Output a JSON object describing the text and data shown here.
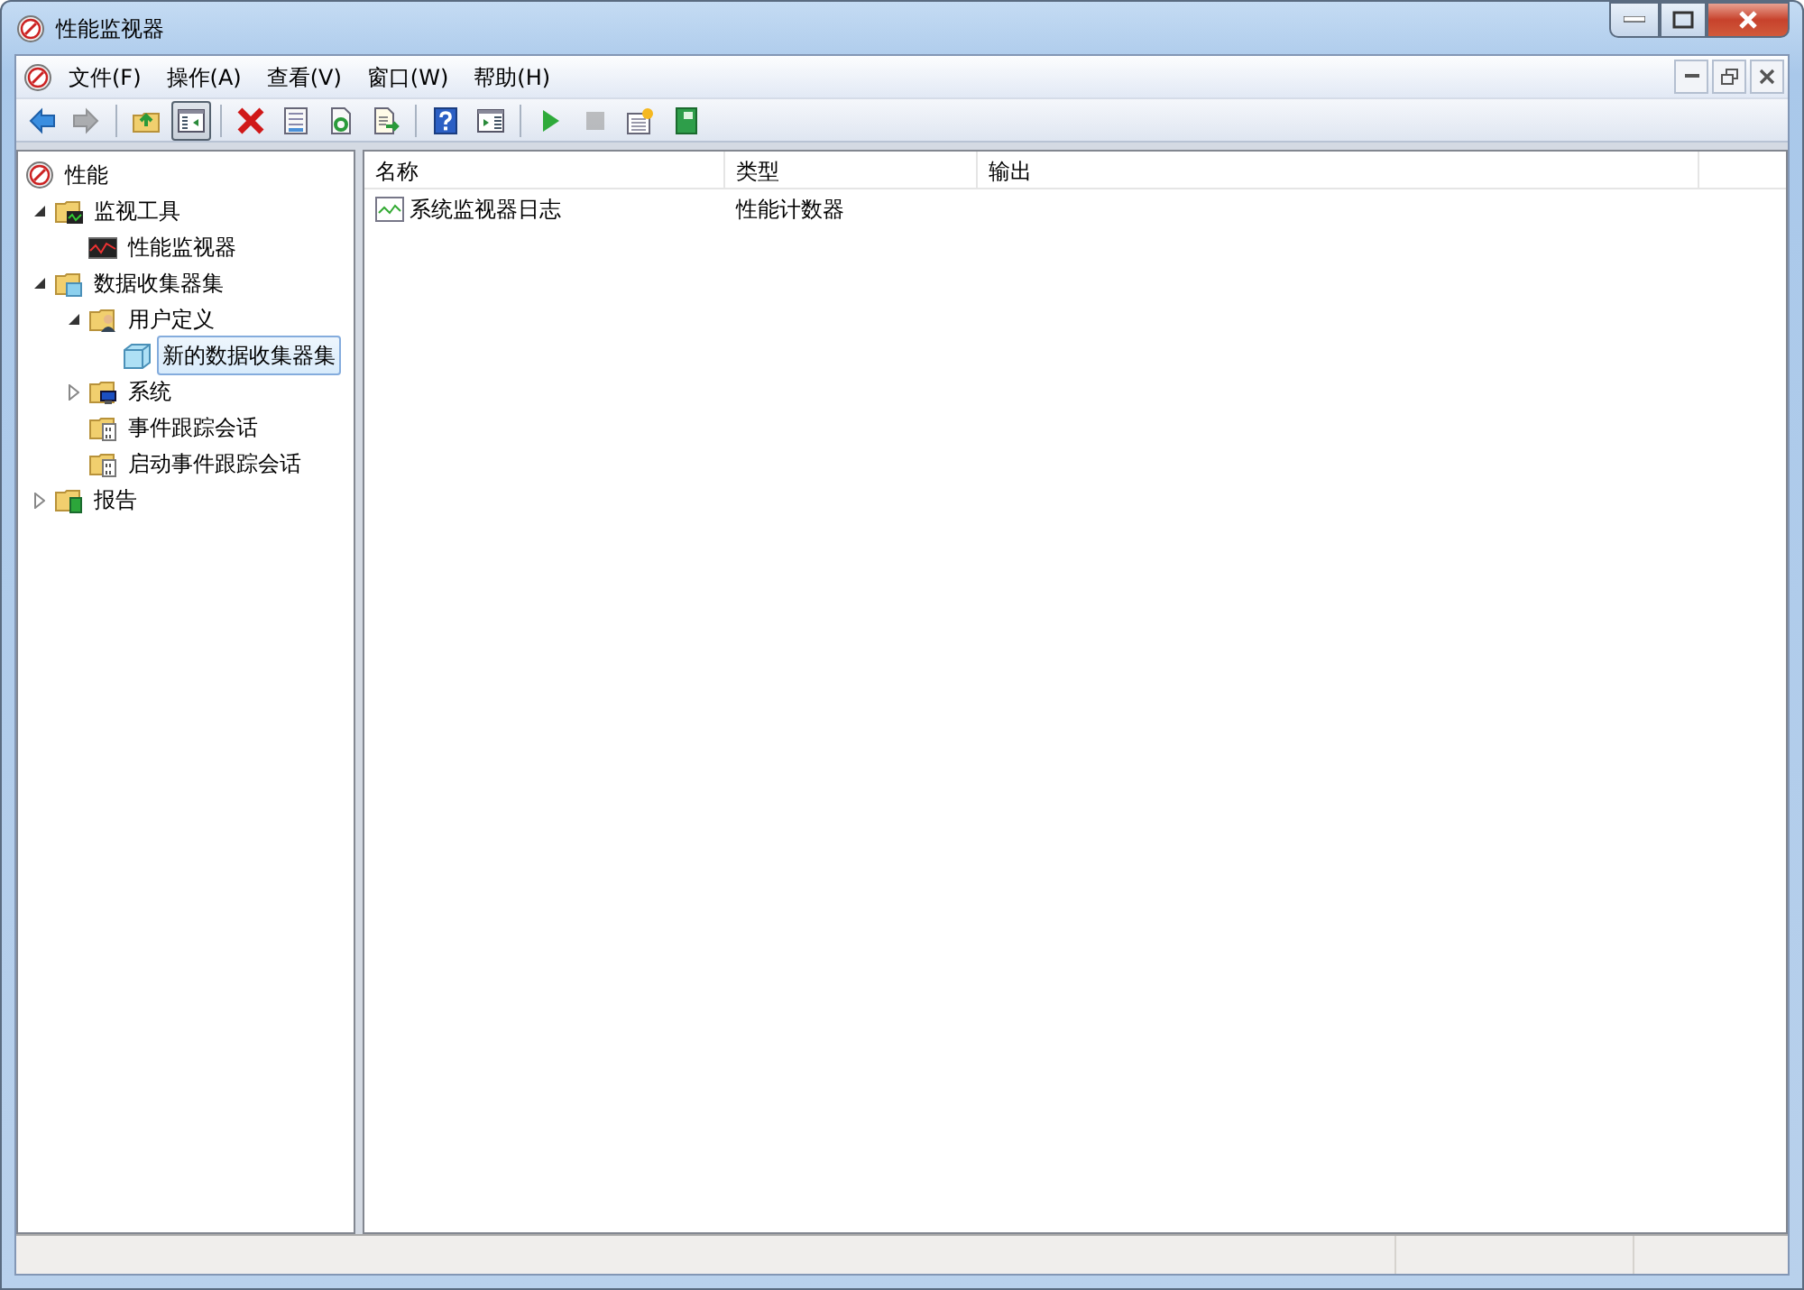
{
  "window": {
    "title": "性能监视器"
  },
  "menu": [
    "文件(F)",
    "操作(A)",
    "查看(V)",
    "窗口(W)",
    "帮助(H)"
  ],
  "toolbar": [
    {
      "kind": "back",
      "disabled": false,
      "pressed": false
    },
    {
      "kind": "forward",
      "disabled": true,
      "pressed": false
    },
    {
      "kind": "sep"
    },
    {
      "kind": "up",
      "disabled": false,
      "pressed": false
    },
    {
      "kind": "tree",
      "disabled": false,
      "pressed": true
    },
    {
      "kind": "sep"
    },
    {
      "kind": "delete",
      "disabled": false,
      "pressed": false
    },
    {
      "kind": "properties",
      "disabled": false,
      "pressed": false
    },
    {
      "kind": "refresh",
      "disabled": false,
      "pressed": false
    },
    {
      "kind": "export",
      "disabled": false,
      "pressed": false
    },
    {
      "kind": "sep"
    },
    {
      "kind": "help",
      "disabled": false,
      "pressed": false
    },
    {
      "kind": "panel",
      "disabled": false,
      "pressed": false
    },
    {
      "kind": "sep"
    },
    {
      "kind": "start",
      "disabled": false,
      "pressed": false
    },
    {
      "kind": "stop",
      "disabled": true,
      "pressed": false
    },
    {
      "kind": "new",
      "disabled": false,
      "pressed": false
    },
    {
      "kind": "report",
      "disabled": false,
      "pressed": false
    }
  ],
  "tree": [
    {
      "label": "性能",
      "kind": "perf",
      "selected": false,
      "children": [
        {
          "label": "监视工具",
          "kind": "tools",
          "expanded": true,
          "selected": false,
          "children": [
            {
              "label": "性能监视器",
              "kind": "graph",
              "selected": false
            }
          ]
        },
        {
          "label": "数据收集器集",
          "kind": "sets",
          "expanded": true,
          "selected": false,
          "children": [
            {
              "label": "用户定义",
              "kind": "user",
              "expanded": true,
              "selected": false,
              "children": [
                {
                  "label": "新的数据收集器集",
                  "kind": "set",
                  "selected": true
                }
              ]
            },
            {
              "label": "系统",
              "kind": "system",
              "expanded": false,
              "selected": false
            },
            {
              "label": "事件跟踪会话",
              "kind": "trace",
              "selected": false
            },
            {
              "label": "启动事件跟踪会话",
              "kind": "trace",
              "selected": false
            }
          ]
        },
        {
          "label": "报告",
          "kind": "report",
          "expanded": false,
          "selected": false
        }
      ]
    }
  ],
  "table": {
    "columns": [
      "名称",
      "类型",
      "输出"
    ],
    "rows": [
      {
        "cells": [
          "系统监视器日志",
          "性能计数器",
          ""
        ]
      }
    ]
  }
}
